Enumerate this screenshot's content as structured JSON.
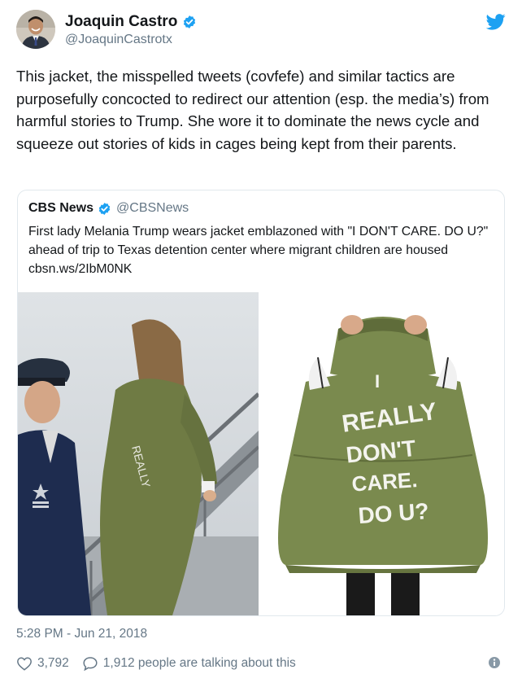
{
  "author": {
    "name": "Joaquin Castro",
    "handle": "@JoaquinCastrotx"
  },
  "tweet": {
    "text": "This jacket, the misspelled tweets (covfefe) and similar tactics are purposefully concocted to redirect our attention (esp. the media’s) from harmful stories to Trump. She wore it to dominate the news cycle and squeeze out stories of kids in cages being kept from their parents.",
    "timestamp": "5:28 PM - Jun 21, 2018"
  },
  "quoted": {
    "name": "CBS News",
    "handle": "@CBSNews",
    "text": "First lady Melania Trump wears jacket emblazoned with \"I DON'T CARE. DO U?\" ahead of trip to Texas detention center where migrant children are housed cbsn.ws/2IbM0NK",
    "jacket_text": [
      "I",
      "REALLY",
      "DON'T",
      "CARE.",
      "DO U?"
    ]
  },
  "footer": {
    "likes": "3,792",
    "talking": "1,912 people are talking about this"
  },
  "icons": {
    "verified": "verified-badge-icon",
    "bird": "twitter-bird-icon",
    "heart": "heart-icon",
    "reply": "speech-bubble-icon",
    "info": "info-icon"
  },
  "colors": {
    "brand_blue": "#1da1f2",
    "text": "#14171a",
    "secondary": "#657786",
    "jacket_green": "#7a8a4e"
  }
}
